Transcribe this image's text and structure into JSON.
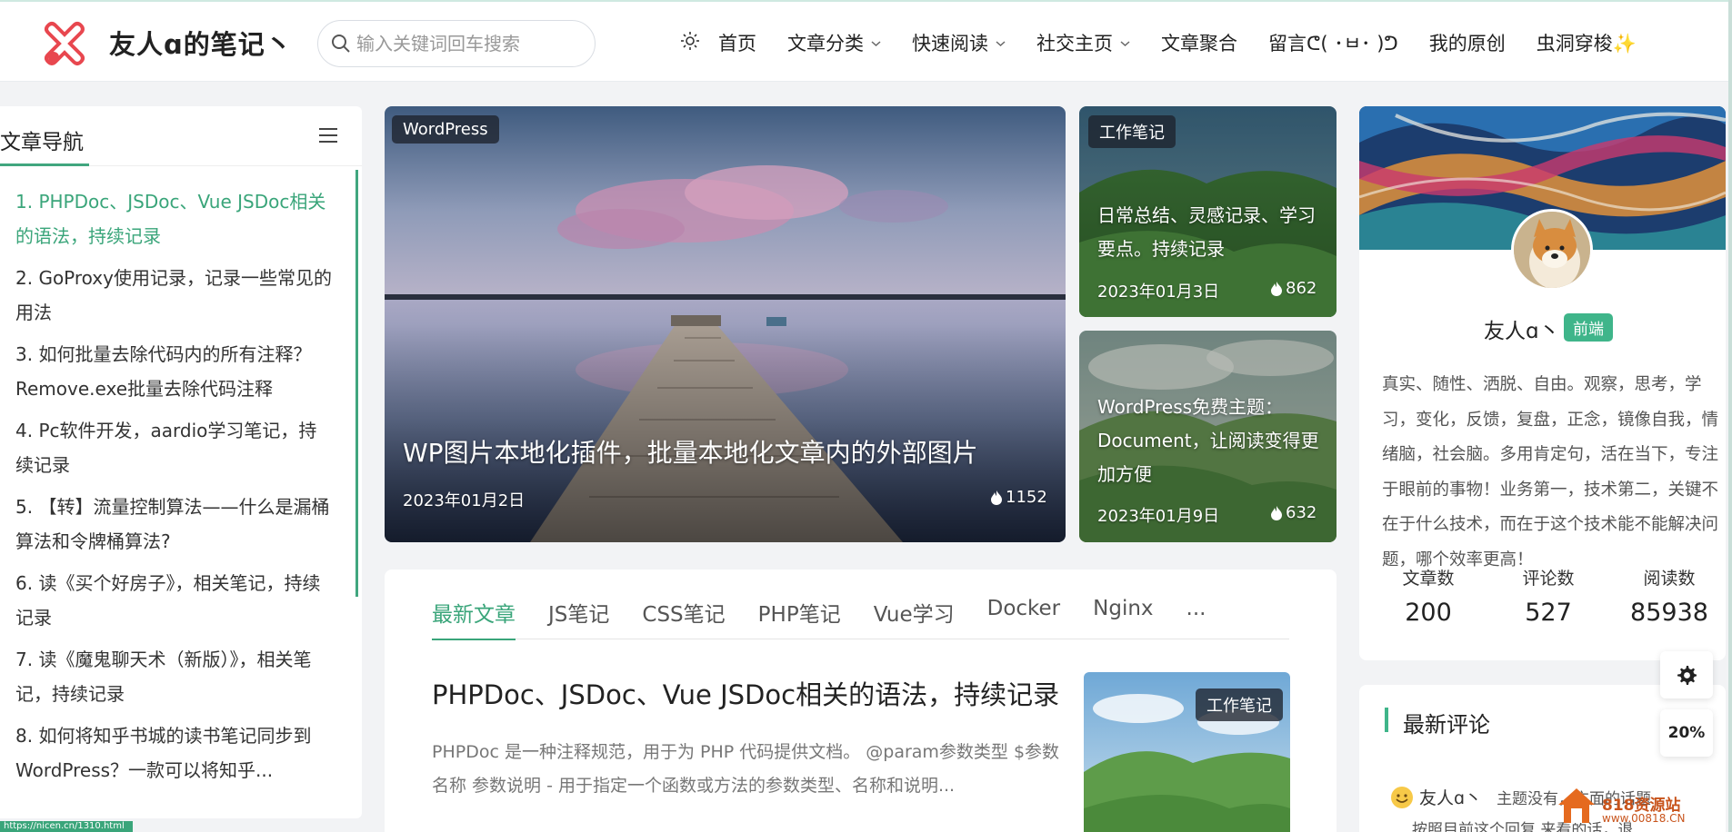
{
  "header": {
    "site_title": "友人ɑ的笔记丶",
    "search_placeholder": "输入关键词回车搜索",
    "nav": [
      {
        "label": "首页",
        "dropdown": false
      },
      {
        "label": "文章分类",
        "dropdown": true
      },
      {
        "label": "快速阅读",
        "dropdown": true
      },
      {
        "label": "社交主页",
        "dropdown": true
      },
      {
        "label": "文章聚合",
        "dropdown": false
      },
      {
        "label": "留言ᕦ( ･ㅂ･ )ᕤ",
        "dropdown": false
      },
      {
        "label": "我的原创",
        "dropdown": false
      },
      {
        "label": "虫洞穿梭✨",
        "dropdown": false
      }
    ]
  },
  "toc": {
    "title": "文章导航",
    "items": [
      "1. PHPDoc、JSDoc、Vue JSDoc相关的语法，持续记录",
      "2. GoProxy使用记录，记录一些常见的用法",
      "3. 如何批量去除代码内的所有注释？Remove.exe批量去除代码注释",
      "4. Pc软件开发，aardio学习笔记，持续记录",
      "5. 【转】流量控制算法——什么是漏桶算法和令牌桶算法?",
      "6. 读《买个好房子》，相关笔记，持续记录",
      "7. 读《魔鬼聊天术（新版）》，相关笔记，持续记录",
      "8. 如何将知乎书城的读书笔记同步到WordPress？一款可以将知乎..."
    ]
  },
  "featured": {
    "main": {
      "tag": "WordPress",
      "title": "WP图片本地化插件，批量本地化文章内的外部图片",
      "date": "2023年01月2日",
      "views": "1152"
    },
    "side1": {
      "tag": "工作笔记",
      "title": "日常总结、灵感记录、学习要点。持续记录",
      "date": "2023年01月3日",
      "views": "862"
    },
    "side2": {
      "title": "WordPress免费主题：Document，让阅读变得更加方便",
      "date": "2023年01月9日",
      "views": "632"
    }
  },
  "articles": {
    "tabs": [
      "最新文章",
      "JS笔记",
      "CSS笔记",
      "PHP笔记",
      "Vue学习",
      "Docker",
      "Nginx",
      "..."
    ],
    "first": {
      "title": "PHPDoc、JSDoc、Vue JSDoc相关的语法，持续记录",
      "excerpt": "PHPDoc 是一种注释规范，用于为 PHP 代码提供文档。 @param参数类型 $参数名称 参数说明 - 用于指定一个函数或方法的参数类型、名称和说明...",
      "tag": "工作笔记"
    }
  },
  "profile": {
    "name": "友人ɑ丶",
    "badge": "前端",
    "bio": "真实、随性、洒脱、自由。观察，思考，学习，变化，反馈，复盘，正念，镜像自我，情绪脑，社会脑。多用肯定句，活在当下，专注于眼前的事物！业务第一，技术第二，关键不在于什么技术，而在于这个技术能不能解决问题，哪个效率更高！",
    "stats": [
      {
        "label": "文章数",
        "value": "200"
      },
      {
        "label": "评论数",
        "value": "527"
      },
      {
        "label": "阅读数",
        "value": "85938"
      }
    ]
  },
  "comments": {
    "title": "最新评论",
    "first_user": "友人ɑ丶",
    "first_text": "主题没有，方面的话题",
    "second_text": "按照目前这个回复 来看的话，退"
  },
  "floating": {
    "progress": "20%"
  },
  "status_url": "https://nicen.cn/1310.html",
  "watermark": {
    "name": "818资源站",
    "url": "www.00818.CN"
  },
  "colors": {
    "accent": "#3aa57a",
    "badge": "#3fb58a"
  }
}
